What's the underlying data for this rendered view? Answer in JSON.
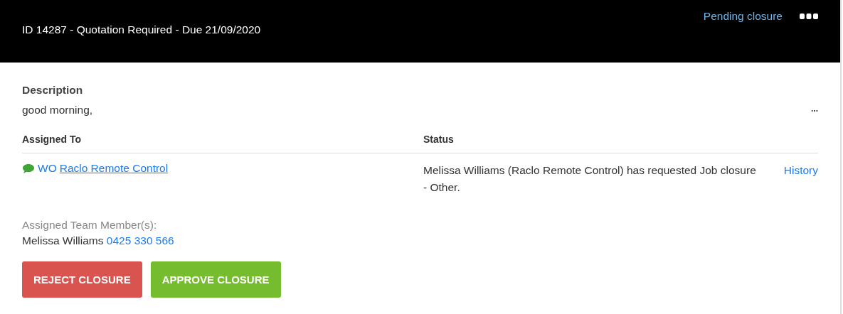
{
  "header": {
    "title": "ID 14287 - Quotation Required - Due 21/09/2020",
    "status": "Pending closure"
  },
  "description": {
    "label": "Description",
    "text": "good morning,",
    "more": "..."
  },
  "columns": [
    "Assigned To",
    "Status"
  ],
  "assignment": {
    "prefix": "WO",
    "company": "Raclo Remote Control",
    "status": "Melissa Williams (Raclo Remote Control) has requested Job closure - Other.",
    "history": "History"
  },
  "team": {
    "label": "Assigned Team Member(s):",
    "name": "Melissa Williams",
    "phone": "0425 330 566"
  },
  "buttons": [
    {
      "label": "REJECT CLOSURE",
      "kind": "reject"
    },
    {
      "label": "APPROVE CLOSURE",
      "kind": "approve"
    }
  ]
}
